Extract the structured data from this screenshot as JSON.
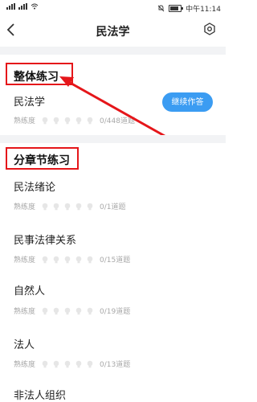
{
  "status_bar": {
    "time_label": "中午11:14"
  },
  "nav": {
    "title": "民法学"
  },
  "overall": {
    "section_title": "整体练习",
    "item": {
      "name": "民法学",
      "proficiency_label": "熟练度",
      "progress_text": "0/448道题",
      "progress": 0,
      "continue_label": "继续作答"
    }
  },
  "chapters": {
    "section_title": "分章节练习",
    "items": [
      {
        "name": "民法绪论",
        "proficiency_label": "熟练度",
        "progress_text": "0/1道题"
      },
      {
        "name": "民事法律关系",
        "proficiency_label": "熟练度",
        "progress_text": "0/15道题"
      },
      {
        "name": "自然人",
        "proficiency_label": "熟练度",
        "progress_text": "0/19道题"
      },
      {
        "name": "法人",
        "proficiency_label": "熟练度",
        "progress_text": "0/13道题"
      },
      {
        "name": "非法人组织"
      }
    ]
  },
  "colors": {
    "accent": "#3b9cf2",
    "annotation": "#e5161a",
    "divider": "#f2f3f5"
  },
  "icons": [
    "back-arrow-icon",
    "settings-gear-icon",
    "lightbulb-icon",
    "wifi-icon",
    "battery-icon",
    "mute-icon"
  ]
}
